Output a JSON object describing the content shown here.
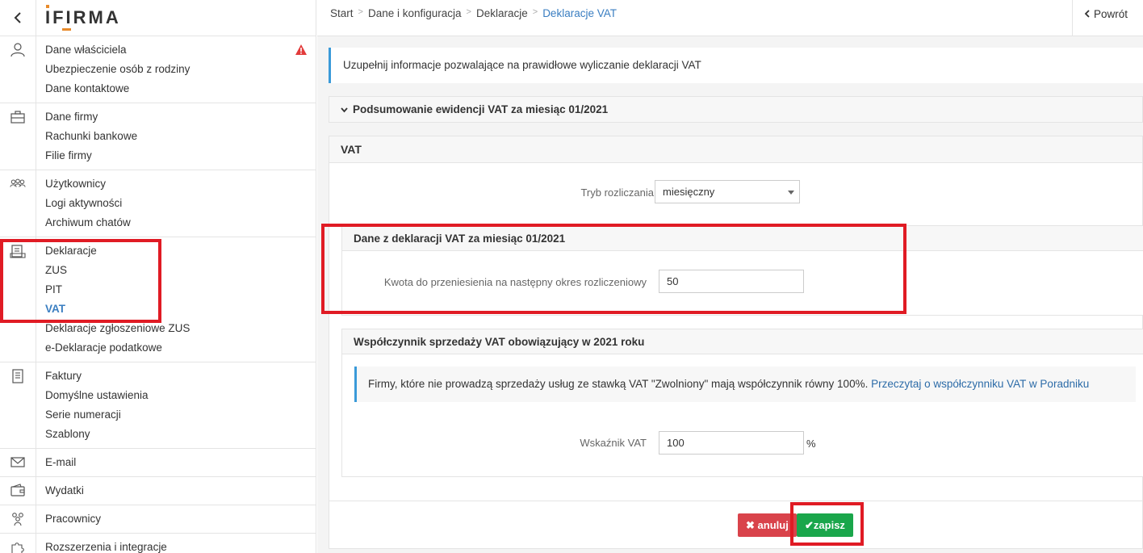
{
  "sidebar": {
    "logo": "IFIRMA",
    "groups": [
      {
        "icon": "user-icon",
        "items": [
          {
            "label": "Dane właściciela",
            "warning": true
          },
          {
            "label": "Ubezpieczenie osób z rodziny"
          },
          {
            "label": "Dane kontaktowe"
          }
        ]
      },
      {
        "icon": "briefcase-icon",
        "items": [
          {
            "label": "Dane firmy"
          },
          {
            "label": "Rachunki bankowe"
          },
          {
            "label": "Filie firmy"
          }
        ]
      },
      {
        "icon": "users-icon",
        "items": [
          {
            "label": "Użytkownicy"
          },
          {
            "label": "Logi aktywności"
          },
          {
            "label": "Archiwum chatów"
          }
        ]
      },
      {
        "icon": "declaration-icon",
        "items": [
          {
            "label": "Deklaracje"
          },
          {
            "label": "ZUS"
          },
          {
            "label": "PIT"
          },
          {
            "label": "VAT",
            "active": true
          },
          {
            "label": "Deklaracje zgłoszeniowe ZUS"
          },
          {
            "label": "e-Deklaracje podatkowe"
          }
        ]
      },
      {
        "icon": "invoice-icon",
        "items": [
          {
            "label": "Faktury"
          },
          {
            "label": "Domyślne ustawienia"
          },
          {
            "label": "Serie numeracji"
          },
          {
            "label": "Szablony"
          }
        ]
      },
      {
        "icon": "envelope-icon",
        "items": [
          {
            "label": "E-mail"
          }
        ]
      },
      {
        "icon": "wallet-icon",
        "items": [
          {
            "label": "Wydatki"
          }
        ]
      },
      {
        "icon": "employees-icon",
        "items": [
          {
            "label": "Pracownicy"
          }
        ]
      },
      {
        "icon": "puzzle-icon",
        "items": [
          {
            "label": "Rozszerzenia i integracje"
          }
        ]
      }
    ]
  },
  "breadcrumb": [
    "Start",
    "Dane i konfiguracja",
    "Deklaracje",
    "Deklaracje VAT"
  ],
  "return_label": "Powrót",
  "info_text": "Uzupełnij informacje pozwalające na prawidłowe wyliczanie deklaracji VAT",
  "summary_title": "Podsumowanie ewidencji VAT za miesiąc 01/2021",
  "vat": {
    "title": "VAT",
    "tryb_label": "Tryb rozliczania",
    "tryb_value": "miesięczny",
    "dane_title": "Dane z deklaracji VAT za miesiąc 01/2021",
    "kwota_label": "Kwota do przeniesienia na następny okres rozliczeniowy",
    "kwota_value": "50",
    "wsp_title": "Współczynnik sprzedaży VAT obowiązujący w 2021 roku",
    "note_text": "Firmy, które nie prowadzą sprzedaży usług ze stawką VAT \"Zwolniony\" mają współczynnik równy 100%.",
    "note_link": "Przeczytaj o współczynniku VAT w Poradniku",
    "wskaznik_label": "Wskaźnik VAT",
    "wskaznik_value": "100",
    "percent": "%",
    "cancel_label": "anuluj",
    "save_label": "zapisz"
  },
  "colors": {
    "accent": "#3a7ec1",
    "highlight": "#e01b24",
    "save": "#1aa64b",
    "cancel": "#d9434b"
  }
}
